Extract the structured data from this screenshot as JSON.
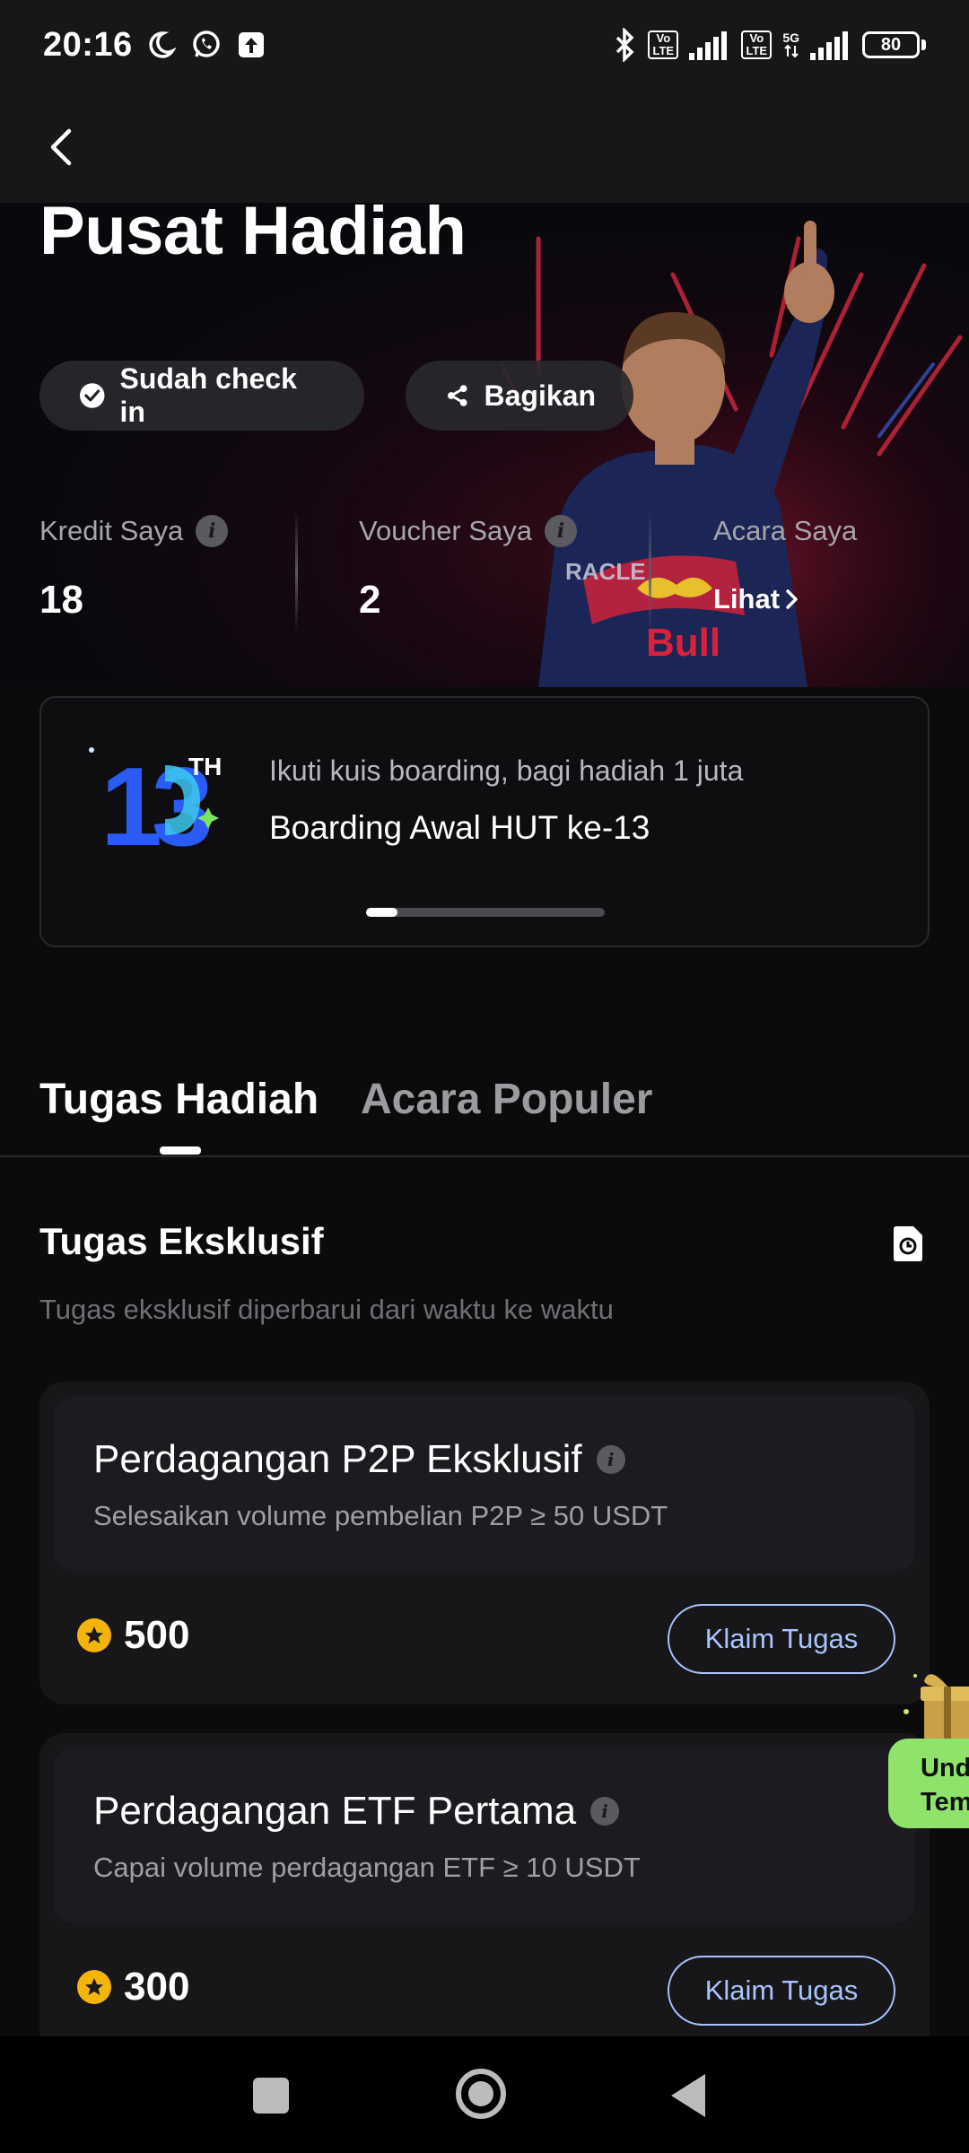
{
  "status_bar": {
    "time": "20:16",
    "volte_label": "Vo LTE",
    "network": "5G",
    "battery": "80"
  },
  "header": {
    "title": "Pusat Hadiah"
  },
  "hero": {
    "checkin_label": "Sudah check in",
    "share_label": "Bagikan",
    "stats": {
      "credit_label": "Kredit Saya",
      "credit_value": "18",
      "voucher_label": "Voucher Saya",
      "voucher_value": "2",
      "events_label": "Acara Saya",
      "events_link": "Lihat"
    }
  },
  "banner": {
    "logo_text": "13",
    "logo_suffix": "TH",
    "subtitle": "Ikuti kuis boarding, bagi hadiah 1 juta",
    "title": "Boarding Awal HUT ke-13",
    "carousel_progress": 0.13
  },
  "tabs": [
    {
      "label": "Tugas Hadiah",
      "active": true
    },
    {
      "label": "Acara Populer",
      "active": false
    }
  ],
  "section": {
    "title": "Tugas Eksklusif",
    "subtitle": "Tugas eksklusif diperbarui dari waktu ke waktu"
  },
  "tasks": [
    {
      "title": "Perdagangan P2P Eksklusif",
      "description": "Selesaikan volume pembelian P2P ≥ 50 USDT",
      "reward": "500",
      "button": "Klaim Tugas"
    },
    {
      "title": "Perdagangan ETF Pertama",
      "description": "Capai volume perdagangan ETF ≥ 10 USDT",
      "reward": "300",
      "button": "Klaim Tugas"
    }
  ],
  "floating_gift": {
    "line1": "Und",
    "line2": "Tem"
  },
  "colors": {
    "accent_blue": "#a9c4ff",
    "coin": "#f5b40a",
    "gift_green": "#8fe36b"
  }
}
